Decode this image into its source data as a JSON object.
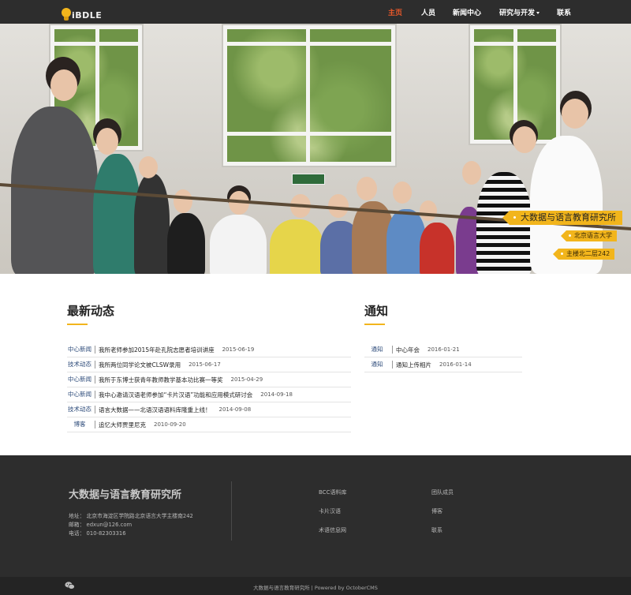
{
  "brand": {
    "logo_text": "iBDLE"
  },
  "nav": {
    "items": [
      {
        "label": "主页",
        "active": true
      },
      {
        "label": "人员",
        "active": false
      },
      {
        "label": "新闻中心",
        "active": false
      },
      {
        "label": "研究与开发",
        "active": false,
        "dropdown": true
      },
      {
        "label": "联系",
        "active": false
      }
    ]
  },
  "hero": {
    "tag_main": "大数据与语言教育研究所",
    "tag_sub1": "北京语言大学",
    "tag_sub2": "主楼北二层242"
  },
  "news": {
    "title": "最新动态",
    "rows": [
      {
        "category": "中心新闻",
        "title": "我所老师参加2015年赴孔院志愿者培训讲座",
        "date": "2015-06-19"
      },
      {
        "category": "技术动态",
        "title": "我所两位同学论文被CLSW录用",
        "date": "2015-06-17"
      },
      {
        "category": "中心新闻",
        "title": "我所于东博士获青年教师教学基本功比赛一等奖",
        "date": "2015-04-29"
      },
      {
        "category": "中心新闻",
        "title": "我中心邀请汉语老师参加“卡片汉语”功能和应用模式研讨会",
        "date": "2014-09-18"
      },
      {
        "category": "技术动态",
        "title": "语言大数据——北语汉语语料库隆重上线！",
        "date": "2014-09-08"
      },
      {
        "category": "博客",
        "title": "追忆大师贾里尼克",
        "date": "2010-09-20"
      }
    ]
  },
  "notices": {
    "title": "通知",
    "rows": [
      {
        "category": "通知",
        "title": "中心年会",
        "date": "2016-01-21"
      },
      {
        "category": "通知",
        "title": "通知上传相片",
        "date": "2016-01-14"
      }
    ]
  },
  "footer": {
    "title": "大数据与语言教育研究所",
    "address": "地址：  北京市海淀区学院路北京语言大学主楼南242",
    "email": "邮箱：  edxun@126.com",
    "phone": "电话：  010-82303316",
    "links_col1": [
      "BCC语料库",
      "卡片汉语",
      "术语信息网"
    ],
    "links_col2": [
      "团队成员",
      "博客",
      "联系"
    ]
  },
  "bottom": {
    "copyright": "大数据与语言教育研究所 | Powered by OctoberCMS",
    "icon": "wechat-icon"
  },
  "colors": {
    "accent": "#f2b51c",
    "nav_active": "#e8582a",
    "dark_bg": "#2d2d2d",
    "category_text": "#2d4b7a"
  }
}
